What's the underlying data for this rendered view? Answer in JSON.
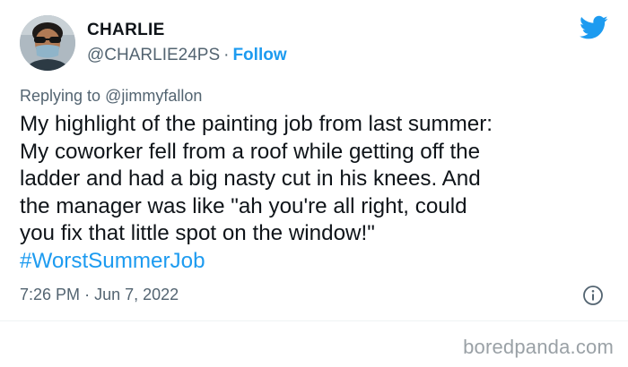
{
  "author": {
    "name": "CHARLIE",
    "handle": "@CHARLIE24PS",
    "separator": "·",
    "follow_label": "Follow"
  },
  "reply": {
    "prefix": "Replying to",
    "target": "@jimmyfallon"
  },
  "tweet": {
    "lines": [
      "My highlight of the painting job from last summer:",
      "My coworker fell from a roof while getting off the",
      "ladder and had a big nasty cut in his knees. And",
      "the manager was like \"ah you're all right, could",
      "you fix that little spot on the window!\""
    ],
    "hashtag": "#WorstSummerJob"
  },
  "meta": {
    "time": "7:26 PM",
    "separator": "·",
    "date": "Jun 7, 2022"
  },
  "watermark": "boredpanda.com",
  "icons": {
    "brand": "twitter-bird-icon",
    "info": "info-icon"
  },
  "colors": {
    "accent": "#1d9bf0",
    "text": "#0f1419",
    "muted": "#536471"
  }
}
